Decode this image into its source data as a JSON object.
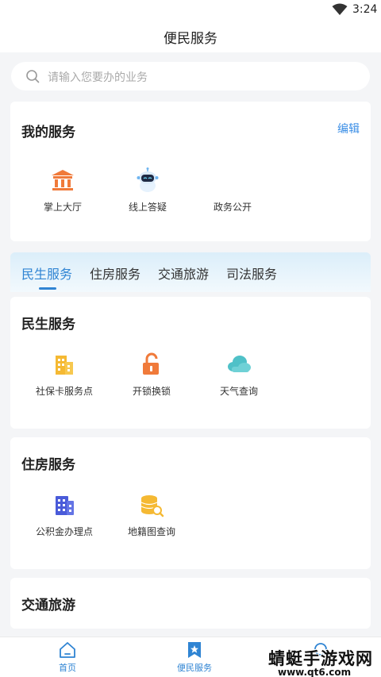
{
  "status_bar": {
    "time": "3:24"
  },
  "header": {
    "title": "便民服务"
  },
  "search": {
    "placeholder": "请输入您要办的业务"
  },
  "my_services": {
    "title": "我的服务",
    "edit_label": "编辑",
    "items": [
      {
        "label": "掌上大厅",
        "icon": "government-hall-icon"
      },
      {
        "label": "线上答疑",
        "icon": "robot-icon"
      },
      {
        "label": "政务公开",
        "icon": ""
      }
    ]
  },
  "tabs": [
    {
      "label": "民生服务",
      "active": true
    },
    {
      "label": "住房服务",
      "active": false
    },
    {
      "label": "交通旅游",
      "active": false
    },
    {
      "label": "司法服务",
      "active": false
    }
  ],
  "sections": [
    {
      "title": "民生服务",
      "items": [
        {
          "label": "社保卡服务点",
          "icon": "building-icon"
        },
        {
          "label": "开锁换锁",
          "icon": "unlock-icon"
        },
        {
          "label": "天气查询",
          "icon": "cloud-icon"
        }
      ]
    },
    {
      "title": "住房服务",
      "items": [
        {
          "label": "公积金办理点",
          "icon": "office-building-icon"
        },
        {
          "label": "地籍图查询",
          "icon": "coin-stack-search-icon"
        }
      ]
    },
    {
      "title": "交通旅游",
      "items": []
    }
  ],
  "bottom_nav": [
    {
      "label": "首页",
      "icon": "home-icon"
    },
    {
      "label": "便民服务",
      "icon": "star-bookmark-icon"
    },
    {
      "label": "",
      "icon": "search-icon"
    }
  ],
  "watermark": {
    "main": "蜻蜓手游戏网",
    "sub": "www.qt6.com"
  },
  "colors": {
    "accent": "#2f84d3",
    "edit": "#3a8ee6",
    "orange": "#f07a3a",
    "teal": "#4fc1c8",
    "yellow": "#f5b933",
    "indigo": "#4a5bd9"
  }
}
